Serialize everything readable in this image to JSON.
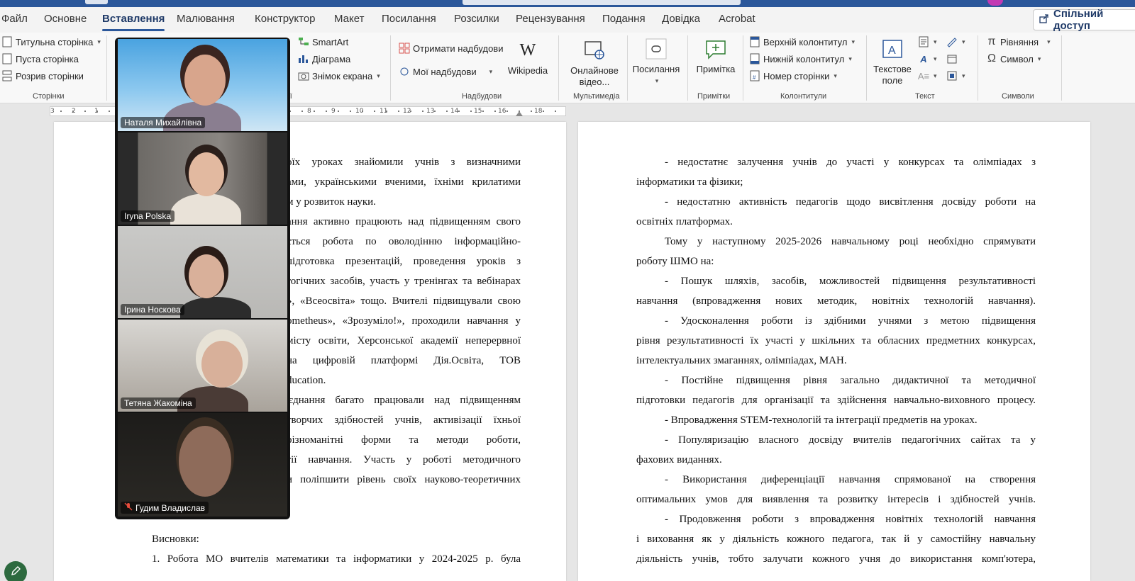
{
  "menu": {
    "tabs": [
      "Файл",
      "Основне",
      "Вставлення",
      "Малювання",
      "Конструктор",
      "Макет",
      "Посилання",
      "Розсилки",
      "Рецензування",
      "Подання",
      "Довідка",
      "Acrobat"
    ],
    "active_tab": "Вставлення",
    "share_label": "Спільний доступ"
  },
  "ribbon": {
    "pages": {
      "items": [
        "Титульна сторінка",
        "Пуста сторінка",
        "Розрив сторінки"
      ],
      "label": "Сторінки"
    },
    "illustrations": {
      "items": [
        "SmartArt",
        "Діаграма",
        "Знімок екрана"
      ],
      "label_partial": "ції"
    },
    "addins": {
      "get_addins": "Отримати надбудови",
      "my_addins": "Мої надбудови",
      "wikipedia": "Wikipedia",
      "label": "Надбудови"
    },
    "media": {
      "online_video": "Онлайнове відео...",
      "label": "Мультимедіа"
    },
    "links": {
      "link": "Посилання"
    },
    "comments": {
      "comment": "Примітка",
      "label": "Примітки"
    },
    "header_footer": {
      "items": [
        "Верхній колонтитул",
        "Нижній колонтитул",
        "Номер сторінки"
      ],
      "label": "Колонтитули"
    },
    "text": {
      "textbox": "Текстове поле",
      "label": "Текст"
    },
    "symbols": {
      "equation": "Рівняння",
      "symbol": "Символ",
      "label": "Символи"
    }
  },
  "ruler": {
    "numbers": [
      "3",
      "2",
      "1",
      "7",
      "8",
      "9",
      "10",
      "11",
      "12",
      "13",
      "14",
      "15",
      "16",
      "18"
    ]
  },
  "participants": [
    {
      "name": "Наталя Михайлівна",
      "muted": false,
      "active": false
    },
    {
      "name": "Iryna Polska",
      "muted": false,
      "active": false
    },
    {
      "name": "Ірина Носкова",
      "muted": false,
      "active": true
    },
    {
      "name": "Тетяна Жакоміна",
      "muted": false,
      "active": false
    },
    {
      "name": "Гудим Владислав",
      "muted": true,
      "active": false
    }
  ],
  "left_page": {
    "lines": [
      "оїх уроках знайомили учнів з визначними",
      "ами, українськими вченими, їхніми крилатими",
      "м у розвиток науки.",
      "ання активно працюють над підвищенням свого",
      "ється робота по оволодінню інформаційно-",
      "підготовка презентацій, проведення уроків з",
      "гогічних засобів, участь у тренінгах та вебінарах",
      "», «Всеосвіта» тощо. Вчителі підвищували свою",
      "ometheus», «Зрозуміло!», проходили навчання у",
      "місту освіти, Херсонської академії неперервної",
      "на цифровій платформі Дія.Освіта, ТОВ",
      "ducation.",
      "'єднання багато працювали над підвищенням",
      "творчих здібностей учнів, активізації їхньої",
      "різноманітні форми та методи роботи,",
      "гії навчання. Участь у роботі методичного",
      "и поліпшити рівень своїх науково-теоретичних"
    ],
    "conclusions_heading": "Висновки:",
    "last_line": "1. Робота МО вчителів математики та інформатики у 2024-2025 р. була"
  },
  "right_page": {
    "lines": [
      "-        недостатнє залучення учнів до участі у конкурсах та олімпіадах з",
      "інформатики та фізики;",
      "-        недостатню активність педагогів щодо висвітлення досвіду роботи на",
      "освітніх платформах.",
      "Тому у наступному 2025-2026 навчальному році необхідно спрямувати",
      "роботу ШМО на:",
      "-        Пошук шляхів, засобів, можливостей підвищення результативності",
      "навчання (впровадження нових методик, новітніх технологій навчання).",
      "-        Удосконалення роботи із здібними учнями з метою підвищення",
      "рівня результативності їх участі у шкільних та обласних предметних конкурсах,",
      "інтелектуальних змаганнях, олімпіадах, МАН.",
      "-        Постійне підвищення рівня загально дидактичної та методичної",
      "підготовки педагогів для організації та здійснення навчально-виховного процесу.",
      "-        Впровадження STEM-технологій та інтеграції предметів на уроках.",
      "-        Популяризацію власного досвіду вчителів педагогічних сайтах та у",
      "фахових виданнях.",
      "-        Використання диференціації навчання спрямованої на створення",
      "оптимальних умов для виявлення та розвитку інтересів і здібностей учнів.",
      "-        Продовження роботи з впровадження новітніх технологій навчання",
      "і виховання як у діяльність кожного педагога, так й у самостійну навчальну",
      "діяльність учнів, тобто залучати кожного учня до використання комп'ютера,"
    ]
  },
  "colors": {
    "accent": "#2b579a",
    "active_speaker": "#34d399",
    "spell_underline": "#c00000"
  }
}
